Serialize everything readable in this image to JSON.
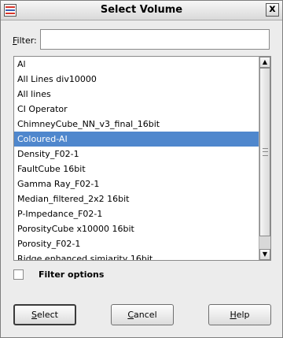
{
  "window": {
    "title": "Select Volume",
    "close_label": "x"
  },
  "filter": {
    "label_accel": "F",
    "label_rest": "ilter:",
    "value": "",
    "placeholder": ""
  },
  "volumes": {
    "items": [
      "Al",
      "All Lines div10000",
      "All lines",
      "CI Operator",
      "ChimneyCube_NN_v3_final_16bit",
      "Coloured-AI",
      "Density_F02-1",
      "FaultCube 16bit",
      "Gamma Ray_F02-1",
      "Median_filtered_2x2 16bit",
      "P-Impedance_F02-1",
      "PorosityCube x10000 16bit",
      "Porosity_F02-1",
      "Ridge enhanced simiarity 16bit"
    ],
    "selected_index": 5
  },
  "options": {
    "filter_options_label": "Filter options",
    "filter_options_checked": false
  },
  "buttons": {
    "select_accel": "S",
    "select_rest": "elect",
    "cancel_accel": "C",
    "cancel_rest": "ancel",
    "help_accel": "H",
    "help_rest": "elp"
  },
  "colors": {
    "selection": "#4f87cd",
    "background": "#ececec"
  },
  "icons": {
    "app": "app-logo-icon",
    "close": "close-icon",
    "scroll_up": "arrow-up-icon",
    "scroll_down": "arrow-down-icon"
  }
}
